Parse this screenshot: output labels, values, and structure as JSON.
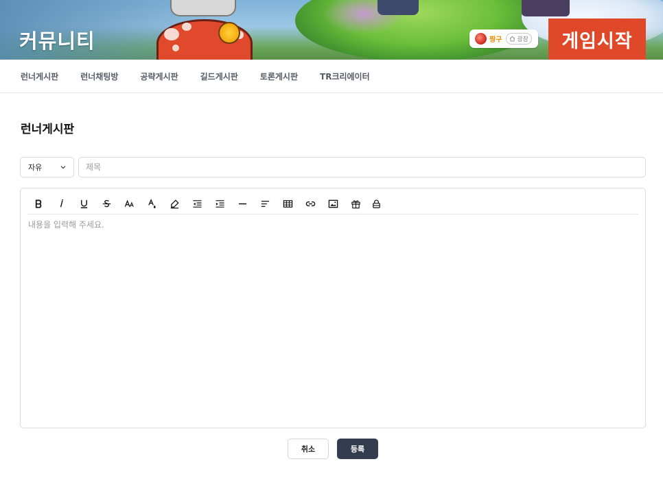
{
  "banner": {
    "title": "커뮤니티",
    "user": {
      "name": "짱구",
      "plaza_label": "광장"
    },
    "game_start_label": "게임시작"
  },
  "nav": {
    "items": [
      {
        "label": "런너게시판"
      },
      {
        "label": "런너채팅방"
      },
      {
        "label": "공략게시판"
      },
      {
        "label": "길드게시판"
      },
      {
        "label": "토론게시판"
      },
      {
        "label": "TR크리에이터"
      }
    ]
  },
  "page": {
    "title": "런너게시판"
  },
  "form": {
    "category": {
      "selected": "자유"
    },
    "title_placeholder": "제목",
    "editor": {
      "placeholder": "내용을 입력해 주세요.",
      "toolbar": [
        {
          "icon": "bold-icon"
        },
        {
          "icon": "italic-icon"
        },
        {
          "icon": "underline-icon"
        },
        {
          "icon": "strikethrough-icon"
        },
        {
          "icon": "font-size-icon"
        },
        {
          "icon": "font-color-icon"
        },
        {
          "icon": "highlight-icon"
        },
        {
          "icon": "outdent-icon"
        },
        {
          "icon": "indent-icon"
        },
        {
          "icon": "horizontal-rule-icon"
        },
        {
          "icon": "align-left-icon"
        },
        {
          "icon": "table-icon"
        },
        {
          "icon": "link-icon"
        },
        {
          "icon": "image-icon"
        },
        {
          "icon": "gift-icon"
        },
        {
          "icon": "lock-icon"
        }
      ]
    },
    "cancel_label": "취소",
    "submit_label": "등록"
  },
  "colors": {
    "game_start_bg": "#e0482a",
    "submit_bg": "#333d4f",
    "username": "#f08c00"
  }
}
